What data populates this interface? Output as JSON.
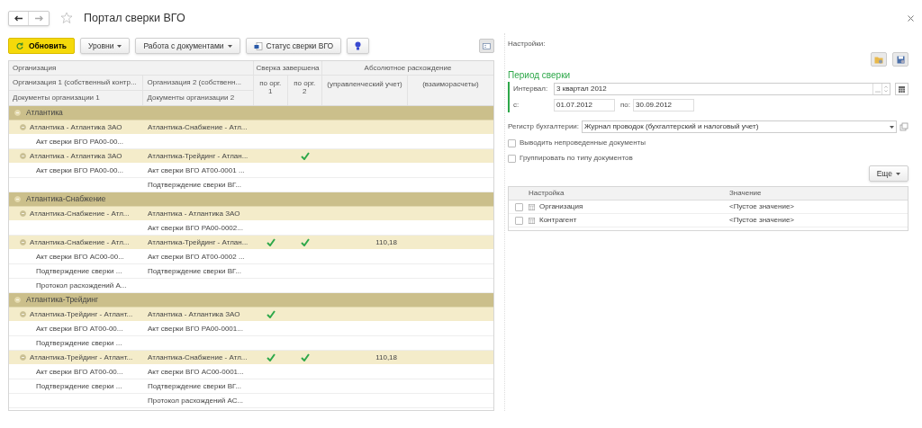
{
  "window": {
    "title": "Портал сверки ВГО",
    "favorite": false
  },
  "toolbar": {
    "refresh": "Обновить",
    "levels": "Уровни",
    "documents": "Работа с документами",
    "status": "Статус сверки ВГО"
  },
  "table": {
    "group_header": "Организация",
    "done_header": "Сверка завершена",
    "diff_header": "Абсолютное расхождение",
    "columns": [
      "Организация 1 (собственный контр...",
      "Организация 2 (собственн...",
      "по орг. 1",
      "по орг. 2",
      "(управленческий учет)",
      "(взаиморасчеты)"
    ],
    "doc_columns": [
      "Документы организации 1",
      "Документы организации 2"
    ],
    "rows": [
      {
        "org": "Атлантика",
        "expanded": true,
        "children": [
          {
            "org1": "Атлантика - Атлантика ЗАО",
            "org2": "Атлантика-Снабжение - Атл...",
            "done1": false,
            "done2": false,
            "expanded": true,
            "children": [
              {
                "doc1": "Акт сверки ВГО РА00-00..."
              }
            ]
          },
          {
            "org1": "Атлантика - Атлантика ЗАО",
            "org2": "Атлантика-Трейдинг - Атлан...",
            "done1": false,
            "done2": true,
            "expanded": true,
            "children": [
              {
                "doc1": "Акт сверки ВГО РА00-00...",
                "doc2": "Акт сверки ВГО АТ00-0001 ..."
              },
              {
                "doc2": "Подтверждение сверки ВГ..."
              }
            ]
          }
        ]
      },
      {
        "org": "Атлантика-Снабжение",
        "expanded": true,
        "children": [
          {
            "org1": "Атлантика-Снабжение - Атл...",
            "org2": "Атлантика - Атлантика ЗАО",
            "done1": false,
            "done2": false,
            "expanded": true,
            "children": [
              {
                "doc2": "Акт сверки ВГО РА00-0002..."
              }
            ]
          },
          {
            "org1": "Атлантика-Снабжение - Атл...",
            "org2": "Атлантика-Трейдинг - Атлан...",
            "done1": true,
            "done2": true,
            "mgmt": "110,18",
            "expanded": true,
            "children": [
              {
                "doc1": "Акт сверки ВГО АС00-00...",
                "doc2": "Акт сверки ВГО АТ00-0002 ..."
              },
              {
                "doc1": "Подтверждение сверки ...",
                "doc2": "Подтверждение сверки ВГ..."
              },
              {
                "doc1": "Протокол расхождений А..."
              }
            ]
          }
        ]
      },
      {
        "org": "Атлантика-Трейдинг",
        "expanded": true,
        "children": [
          {
            "org1": "Атлантика-Трейдинг - Атлант...",
            "org2": "Атлантика - Атлантика ЗАО",
            "done1": true,
            "done2": false,
            "expanded": true,
            "children": [
              {
                "doc1": "Акт сверки ВГО АТ00-00...",
                "doc2": "Акт сверки ВГО РА00-0001..."
              },
              {
                "doc1": "Подтверждение сверки ..."
              }
            ]
          },
          {
            "org1": "Атлантика-Трейдинг - Атлант...",
            "org2": "Атлантика-Снабжение - Атл...",
            "done1": true,
            "done2": true,
            "mgmt": "110,18",
            "expanded": true,
            "children": [
              {
                "doc1": "Акт сверки ВГО АТ00-00...",
                "doc2": "Акт сверки ВГО АС00-0001..."
              },
              {
                "doc1": "Подтверждение сверки ...",
                "doc2": "Подтверждение сверки ВГ..."
              },
              {
                "doc2": "Протокол расхождений АС..."
              }
            ]
          }
        ]
      }
    ]
  },
  "settings": {
    "label": "Настройки:",
    "period_title": "Период сверки",
    "interval_label": "Интервал:",
    "interval": "3 квартал 2012",
    "from_label": "с:",
    "from": "01.07.2012",
    "to_label": "по:",
    "to": "30.09.2012",
    "register_label": "Регистр бухгалтерии:",
    "register": "Журнал проводок (бухгалтерский и налоговый учет)",
    "options": [
      {
        "label": "Выводить непроведенные документы",
        "checked": false
      },
      {
        "label": "Группировать по типу документов",
        "checked": false
      }
    ],
    "more": "Еще",
    "columns": [
      "Настройка",
      "Значение"
    ],
    "items": [
      {
        "name": "Организация",
        "value": "<Пустое значение>",
        "checked": false
      },
      {
        "name": "Контрагент",
        "value": "<Пустое значение>",
        "checked": false
      }
    ]
  }
}
